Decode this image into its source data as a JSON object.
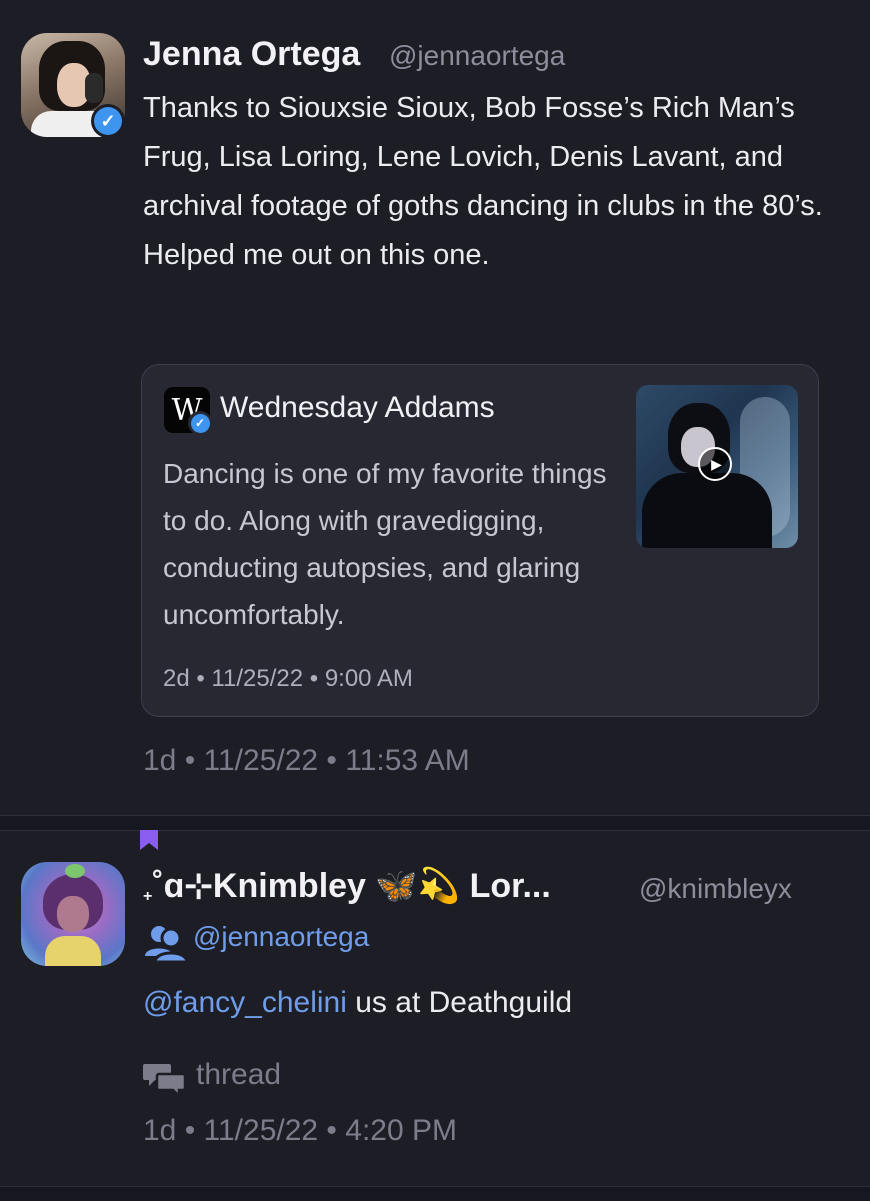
{
  "post": {
    "author_name": "Jenna Ortega",
    "author_handle": "@jennaortega",
    "avatar_icon": "profile-photo",
    "verified_icon": "verified-check-icon",
    "body": "Thanks to Siouxsie Sioux, Bob Fosse’s Rich Man’s Frug, Lisa Loring, Lene Lovich, Denis Lavant, and archival footage of goths dancing in clubs in the 80’s. Helped me out on this one.",
    "meta": "1d • 11/25/22 • 11:53 AM",
    "quote": {
      "logo_letter": "W",
      "author_name": "Wednesday Addams",
      "body": "Dancing is one of my favorite things to do. Along with gravedigging, conducting autopsies, and glaring uncomfortably.",
      "meta": "2d • 11/25/22 • 9:00 AM",
      "media_icon": "play-icon"
    }
  },
  "reply": {
    "author_prefix": "˚ɑ⊹Knimbley",
    "author_suffix": "Lor...",
    "sparkle": "+",
    "emoji_butterfly": "🦋",
    "emoji_dizzy": "💫",
    "author_handle": "@knimbleyx",
    "reply_to": "@jennaortega",
    "mention": "@fancy_chelini",
    "body_rest": " us at Deathguild",
    "thread_label": "thread",
    "meta": "1d • 11/25/22 • 4:20 PM"
  },
  "colors": {
    "background": "#1d1d26",
    "link": "#6f9dea",
    "verified": "#3d95f0",
    "bookmark": "#8a5cf0",
    "muted": "#7c7c8a"
  }
}
